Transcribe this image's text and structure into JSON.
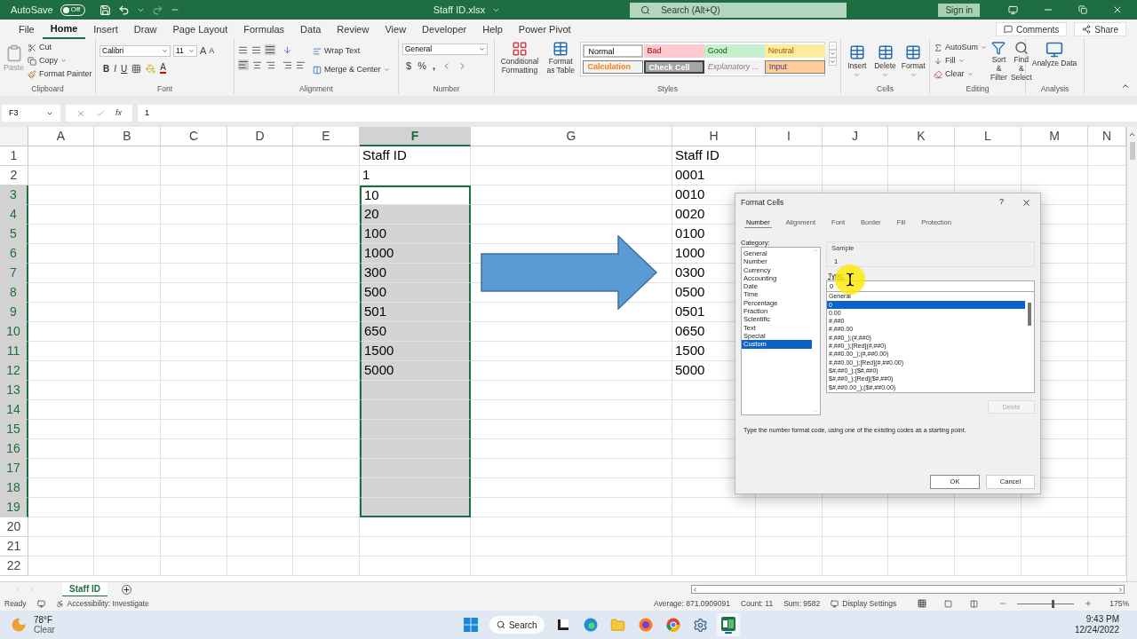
{
  "title_bar": {
    "autosave_label": "AutoSave",
    "autosave_state": "Off",
    "autosave_on": false,
    "file_name": "Staff ID.xlsx",
    "search_placeholder": "Search (Alt+Q)",
    "sign_in": "Sign in"
  },
  "menu_tabs": [
    {
      "label": "File",
      "selected": false
    },
    {
      "label": "Home",
      "selected": true
    },
    {
      "label": "Insert",
      "selected": false
    },
    {
      "label": "Draw",
      "selected": false
    },
    {
      "label": "Page Layout",
      "selected": false
    },
    {
      "label": "Formulas",
      "selected": false
    },
    {
      "label": "Data",
      "selected": false
    },
    {
      "label": "Review",
      "selected": false
    },
    {
      "label": "View",
      "selected": false
    },
    {
      "label": "Developer",
      "selected": false
    },
    {
      "label": "Help",
      "selected": false
    },
    {
      "label": "Power Pivot",
      "selected": false
    }
  ],
  "comments": "Comments",
  "share": "Share",
  "ribbon": {
    "clipboard": {
      "label": "Clipboard",
      "paste": "Paste",
      "cut": "Cut",
      "copy": "Copy",
      "format_painter": "Format Painter"
    },
    "font": {
      "label": "Font",
      "name": "Calibri",
      "size": "11",
      "grow": "A",
      "shrink": "A",
      "bold": "B",
      "italic": "I",
      "underline": "U",
      "color_letter": "A"
    },
    "alignment": {
      "label": "Alignment",
      "wrap_text": "Wrap Text",
      "merge": "Merge & Center"
    },
    "number": {
      "label": "Number",
      "format": "General",
      "currency": "$",
      "percent": "%",
      "comma": ","
    },
    "styles": {
      "label": "Styles",
      "conditional": "Conditional Formatting",
      "format_table": "Format as Table",
      "items": [
        {
          "label": "Normal",
          "kind": "normal"
        },
        {
          "label": "Bad",
          "kind": "bad"
        },
        {
          "label": "Good",
          "kind": "good"
        },
        {
          "label": "Neutral",
          "kind": "neutral"
        },
        {
          "label": "Calculation",
          "kind": "calculation"
        },
        {
          "label": "Check Cell",
          "kind": "check"
        },
        {
          "label": "Explanatory ...",
          "kind": "explanatory"
        },
        {
          "label": "Input",
          "kind": "input"
        }
      ]
    },
    "cells": {
      "label": "Cells",
      "insert": "Insert",
      "delete": "Delete",
      "format": "Format"
    },
    "editing": {
      "label": "Editing",
      "autosum": "AutoSum",
      "fill": "Fill",
      "clear": "Clear",
      "sort": "Sort & Filter",
      "find": "Find & Select"
    },
    "analysis": {
      "label": "Analysis",
      "analyze": "Analyze Data"
    }
  },
  "formula_bar": {
    "name_box": "F3",
    "fx": "fx",
    "value": "1"
  },
  "sheet": {
    "columns": [
      {
        "label": "A",
        "selected": false
      },
      {
        "label": "B",
        "selected": false
      },
      {
        "label": "C",
        "selected": false
      },
      {
        "label": "D",
        "selected": false
      },
      {
        "label": "E",
        "selected": false
      },
      {
        "label": "F",
        "selected": true
      },
      {
        "label": "G",
        "selected": false
      },
      {
        "label": "H",
        "selected": false
      },
      {
        "label": "I",
        "selected": false
      },
      {
        "label": "J",
        "selected": false
      },
      {
        "label": "K",
        "selected": false
      },
      {
        "label": "L",
        "selected": false
      },
      {
        "label": "M",
        "selected": false
      },
      {
        "label": "N",
        "selected": false
      }
    ],
    "rows": [
      {
        "label": "1",
        "selected": false
      },
      {
        "label": "2",
        "selected": false
      },
      {
        "label": "3",
        "selected": true
      },
      {
        "label": "4",
        "selected": true
      },
      {
        "label": "5",
        "selected": true
      },
      {
        "label": "6",
        "selected": true
      },
      {
        "label": "7",
        "selected": true
      },
      {
        "label": "8",
        "selected": true
      },
      {
        "label": "9",
        "selected": true
      },
      {
        "label": "10",
        "selected": true
      },
      {
        "label": "11",
        "selected": true
      },
      {
        "label": "12",
        "selected": true
      },
      {
        "label": "13",
        "selected": true
      },
      {
        "label": "14",
        "selected": true
      },
      {
        "label": "15",
        "selected": true
      },
      {
        "label": "16",
        "selected": true
      },
      {
        "label": "17",
        "selected": true
      },
      {
        "label": "18",
        "selected": true
      },
      {
        "label": "19",
        "selected": true
      },
      {
        "label": "20",
        "selected": false
      },
      {
        "label": "21",
        "selected": false
      },
      {
        "label": "22",
        "selected": false
      }
    ],
    "column_f": [
      "Staff ID",
      "1",
      "10",
      "20",
      "100",
      "1000",
      "300",
      "500",
      "501",
      "650",
      "1500",
      "5000"
    ],
    "column_h": [
      "Staff ID",
      "0001",
      "0010",
      "0020",
      "0100",
      "1000",
      "0300",
      "0500",
      "0501",
      "0650",
      "1500",
      "5000"
    ]
  },
  "dialog": {
    "title": "Format Cells",
    "help": "?",
    "tabs": [
      {
        "label": "Number",
        "selected": true
      },
      {
        "label": "Alignment",
        "selected": false
      },
      {
        "label": "Font",
        "selected": false
      },
      {
        "label": "Border",
        "selected": false
      },
      {
        "label": "Fill",
        "selected": false
      },
      {
        "label": "Protection",
        "selected": false
      }
    ],
    "category_label": "Category:",
    "categories": [
      {
        "label": "General",
        "selected": false
      },
      {
        "label": "Number",
        "selected": false
      },
      {
        "label": "Currency",
        "selected": false
      },
      {
        "label": "Accounting",
        "selected": false
      },
      {
        "label": "Date",
        "selected": false
      },
      {
        "label": "Time",
        "selected": false
      },
      {
        "label": "Percentage",
        "selected": false
      },
      {
        "label": "Fraction",
        "selected": false
      },
      {
        "label": "Scientific",
        "selected": false
      },
      {
        "label": "Text",
        "selected": false
      },
      {
        "label": "Special",
        "selected": false
      },
      {
        "label": "Custom",
        "selected": true
      }
    ],
    "sample_label": "Sample",
    "sample_value": "1",
    "type_label": "Type:",
    "type_value": "0",
    "formats": [
      {
        "label": "General",
        "selected": false
      },
      {
        "label": "0",
        "selected": true
      },
      {
        "label": "0.00",
        "selected": false
      },
      {
        "label": "#,##0",
        "selected": false
      },
      {
        "label": "#,##0.00",
        "selected": false
      },
      {
        "label": "#,##0_);(#,##0)",
        "selected": false
      },
      {
        "label": "#,##0_);[Red](#,##0)",
        "selected": false
      },
      {
        "label": "#,##0.00_);(#,##0.00)",
        "selected": false
      },
      {
        "label": "#,##0.00_);[Red](#,##0.00)",
        "selected": false
      },
      {
        "label": "$#,##0_);($#,##0)",
        "selected": false
      },
      {
        "label": "$#,##0_);[Red]($#,##0)",
        "selected": false
      },
      {
        "label": "$#,##0.00_);($#,##0.00)",
        "selected": false
      }
    ],
    "delete": "Delete",
    "delete_disabled": true,
    "hint": "Type the number format code, using one of the existing codes as a starting point.",
    "ok": "OK",
    "cancel": "Cancel"
  },
  "sheet_tabs": [
    {
      "label": "Staff ID",
      "selected": true
    }
  ],
  "status_bar": {
    "ready": "Ready",
    "accessibility": "Accessibility: Investigate",
    "average": "Average: 871.0909091",
    "count": "Count: 11",
    "sum": "Sum: 9582",
    "display_settings": "Display Settings",
    "zoom_slider": {
      "level": 0.62
    },
    "zoom": "175%"
  },
  "taskbar": {
    "temperature": "78°F",
    "weather": "Clear",
    "search": "Search",
    "time": "9:43 PM",
    "date": "12/24/2022"
  }
}
